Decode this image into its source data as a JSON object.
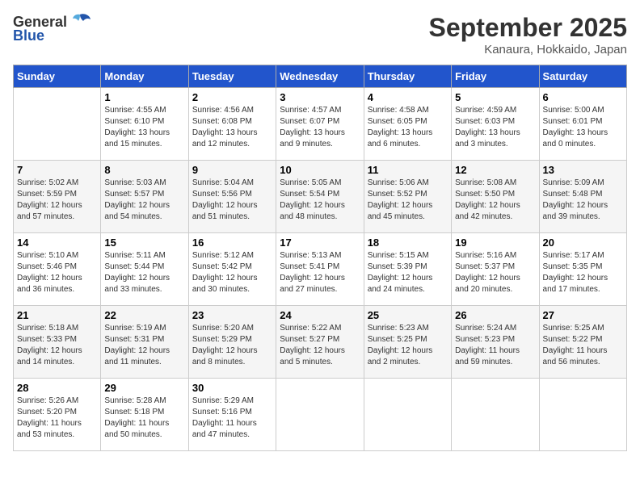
{
  "header": {
    "logo_general": "General",
    "logo_blue": "Blue",
    "month": "September 2025",
    "location": "Kanaura, Hokkaido, Japan"
  },
  "days_of_week": [
    "Sunday",
    "Monday",
    "Tuesday",
    "Wednesday",
    "Thursday",
    "Friday",
    "Saturday"
  ],
  "weeks": [
    [
      {
        "day": "",
        "info": ""
      },
      {
        "day": "1",
        "info": "Sunrise: 4:55 AM\nSunset: 6:10 PM\nDaylight: 13 hours\nand 15 minutes."
      },
      {
        "day": "2",
        "info": "Sunrise: 4:56 AM\nSunset: 6:08 PM\nDaylight: 13 hours\nand 12 minutes."
      },
      {
        "day": "3",
        "info": "Sunrise: 4:57 AM\nSunset: 6:07 PM\nDaylight: 13 hours\nand 9 minutes."
      },
      {
        "day": "4",
        "info": "Sunrise: 4:58 AM\nSunset: 6:05 PM\nDaylight: 13 hours\nand 6 minutes."
      },
      {
        "day": "5",
        "info": "Sunrise: 4:59 AM\nSunset: 6:03 PM\nDaylight: 13 hours\nand 3 minutes."
      },
      {
        "day": "6",
        "info": "Sunrise: 5:00 AM\nSunset: 6:01 PM\nDaylight: 13 hours\nand 0 minutes."
      }
    ],
    [
      {
        "day": "7",
        "info": "Sunrise: 5:02 AM\nSunset: 5:59 PM\nDaylight: 12 hours\nand 57 minutes."
      },
      {
        "day": "8",
        "info": "Sunrise: 5:03 AM\nSunset: 5:57 PM\nDaylight: 12 hours\nand 54 minutes."
      },
      {
        "day": "9",
        "info": "Sunrise: 5:04 AM\nSunset: 5:56 PM\nDaylight: 12 hours\nand 51 minutes."
      },
      {
        "day": "10",
        "info": "Sunrise: 5:05 AM\nSunset: 5:54 PM\nDaylight: 12 hours\nand 48 minutes."
      },
      {
        "day": "11",
        "info": "Sunrise: 5:06 AM\nSunset: 5:52 PM\nDaylight: 12 hours\nand 45 minutes."
      },
      {
        "day": "12",
        "info": "Sunrise: 5:08 AM\nSunset: 5:50 PM\nDaylight: 12 hours\nand 42 minutes."
      },
      {
        "day": "13",
        "info": "Sunrise: 5:09 AM\nSunset: 5:48 PM\nDaylight: 12 hours\nand 39 minutes."
      }
    ],
    [
      {
        "day": "14",
        "info": "Sunrise: 5:10 AM\nSunset: 5:46 PM\nDaylight: 12 hours\nand 36 minutes."
      },
      {
        "day": "15",
        "info": "Sunrise: 5:11 AM\nSunset: 5:44 PM\nDaylight: 12 hours\nand 33 minutes."
      },
      {
        "day": "16",
        "info": "Sunrise: 5:12 AM\nSunset: 5:42 PM\nDaylight: 12 hours\nand 30 minutes."
      },
      {
        "day": "17",
        "info": "Sunrise: 5:13 AM\nSunset: 5:41 PM\nDaylight: 12 hours\nand 27 minutes."
      },
      {
        "day": "18",
        "info": "Sunrise: 5:15 AM\nSunset: 5:39 PM\nDaylight: 12 hours\nand 24 minutes."
      },
      {
        "day": "19",
        "info": "Sunrise: 5:16 AM\nSunset: 5:37 PM\nDaylight: 12 hours\nand 20 minutes."
      },
      {
        "day": "20",
        "info": "Sunrise: 5:17 AM\nSunset: 5:35 PM\nDaylight: 12 hours\nand 17 minutes."
      }
    ],
    [
      {
        "day": "21",
        "info": "Sunrise: 5:18 AM\nSunset: 5:33 PM\nDaylight: 12 hours\nand 14 minutes."
      },
      {
        "day": "22",
        "info": "Sunrise: 5:19 AM\nSunset: 5:31 PM\nDaylight: 12 hours\nand 11 minutes."
      },
      {
        "day": "23",
        "info": "Sunrise: 5:20 AM\nSunset: 5:29 PM\nDaylight: 12 hours\nand 8 minutes."
      },
      {
        "day": "24",
        "info": "Sunrise: 5:22 AM\nSunset: 5:27 PM\nDaylight: 12 hours\nand 5 minutes."
      },
      {
        "day": "25",
        "info": "Sunrise: 5:23 AM\nSunset: 5:25 PM\nDaylight: 12 hours\nand 2 minutes."
      },
      {
        "day": "26",
        "info": "Sunrise: 5:24 AM\nSunset: 5:23 PM\nDaylight: 11 hours\nand 59 minutes."
      },
      {
        "day": "27",
        "info": "Sunrise: 5:25 AM\nSunset: 5:22 PM\nDaylight: 11 hours\nand 56 minutes."
      }
    ],
    [
      {
        "day": "28",
        "info": "Sunrise: 5:26 AM\nSunset: 5:20 PM\nDaylight: 11 hours\nand 53 minutes."
      },
      {
        "day": "29",
        "info": "Sunrise: 5:28 AM\nSunset: 5:18 PM\nDaylight: 11 hours\nand 50 minutes."
      },
      {
        "day": "30",
        "info": "Sunrise: 5:29 AM\nSunset: 5:16 PM\nDaylight: 11 hours\nand 47 minutes."
      },
      {
        "day": "",
        "info": ""
      },
      {
        "day": "",
        "info": ""
      },
      {
        "day": "",
        "info": ""
      },
      {
        "day": "",
        "info": ""
      }
    ]
  ]
}
